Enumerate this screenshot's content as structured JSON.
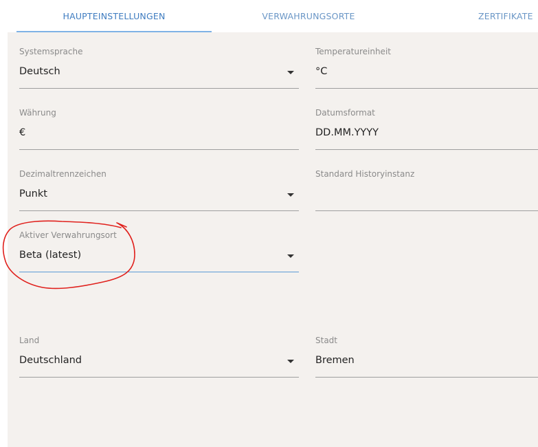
{
  "tabs": [
    {
      "label": "HAUPTEINSTELLUNGEN",
      "active": true
    },
    {
      "label": "VERWAHRUNGSORTE",
      "active": false
    },
    {
      "label": "ZERTIFIKATE",
      "active": false
    }
  ],
  "fields": {
    "systemsprache": {
      "label": "Systemsprache",
      "value": "Deutsch"
    },
    "temperatureinheit": {
      "label": "Temperatureinheit",
      "value": "°C"
    },
    "waehrung": {
      "label": "Währung",
      "value": "€"
    },
    "datumsformat": {
      "label": "Datumsformat",
      "value": "DD.MM.YYYY"
    },
    "dezimaltrennzeichen": {
      "label": "Dezimaltrennzeichen",
      "value": "Punkt"
    },
    "standard_historyinstanz": {
      "label": "Standard Historyinstanz",
      "value": ""
    },
    "aktiver_verwahrungsort": {
      "label": "Aktiver Verwahrungsort",
      "value": "Beta (latest)"
    },
    "land": {
      "label": "Land",
      "value": "Deutschland"
    },
    "stadt": {
      "label": "Stadt",
      "value": "Bremen"
    }
  },
  "colors": {
    "accent": "#3f7cc0",
    "panel_background": "#f4f1ee",
    "annotation": "#e0201c"
  },
  "icons": {
    "dropdown": "chevron-down-icon"
  }
}
